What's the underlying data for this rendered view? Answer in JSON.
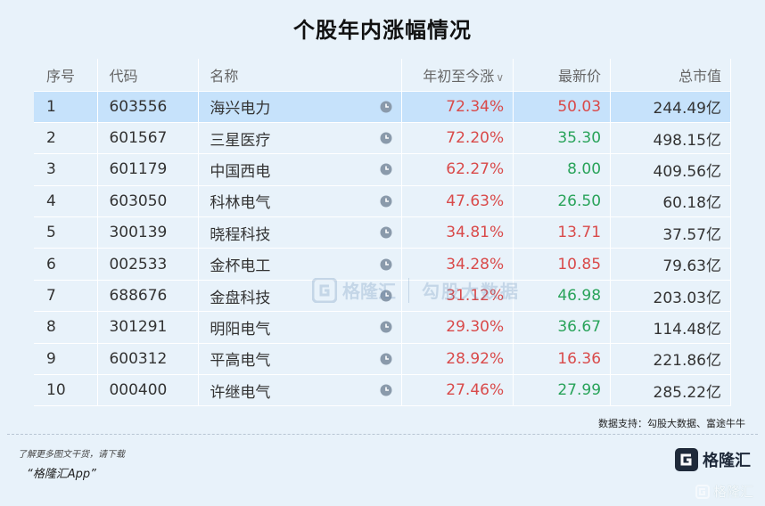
{
  "title": "个股年内涨幅情况",
  "headers": {
    "index": "序号",
    "code": "代码",
    "name": "名称",
    "change": "年初至今涨",
    "price": "最新价",
    "market_cap": "总市值"
  },
  "sort_arrow": "∨",
  "rows": [
    {
      "index": "1",
      "code": "603556",
      "name": "海兴电力",
      "change": "72.34%",
      "price": "50.03",
      "market_cap": "244.49亿",
      "price_dir": "red"
    },
    {
      "index": "2",
      "code": "601567",
      "name": "三星医疗",
      "change": "72.20%",
      "price": "35.30",
      "market_cap": "498.15亿",
      "price_dir": "green"
    },
    {
      "index": "3",
      "code": "601179",
      "name": "中国西电",
      "change": "62.27%",
      "price": "8.00",
      "market_cap": "409.56亿",
      "price_dir": "green"
    },
    {
      "index": "4",
      "code": "603050",
      "name": "科林电气",
      "change": "47.63%",
      "price": "26.50",
      "market_cap": "60.18亿",
      "price_dir": "green"
    },
    {
      "index": "5",
      "code": "300139",
      "name": "晓程科技",
      "change": "34.81%",
      "price": "13.71",
      "market_cap": "37.57亿",
      "price_dir": "red"
    },
    {
      "index": "6",
      "code": "002533",
      "name": "金杯电工",
      "change": "34.28%",
      "price": "10.85",
      "market_cap": "79.63亿",
      "price_dir": "red"
    },
    {
      "index": "7",
      "code": "688676",
      "name": "金盘科技",
      "change": "31.12%",
      "price": "46.98",
      "market_cap": "203.03亿",
      "price_dir": "green"
    },
    {
      "index": "8",
      "code": "301291",
      "name": "明阳电气",
      "change": "29.30%",
      "price": "36.67",
      "market_cap": "114.48亿",
      "price_dir": "green"
    },
    {
      "index": "9",
      "code": "600312",
      "name": "平高电气",
      "change": "28.92%",
      "price": "16.36",
      "market_cap": "221.86亿",
      "price_dir": "red"
    },
    {
      "index": "10",
      "code": "000400",
      "name": "许继电气",
      "change": "27.46%",
      "price": "27.99",
      "market_cap": "285.22亿",
      "price_dir": "green"
    }
  ],
  "source": "数据支持：勾股大数据、富途牛牛",
  "promo_line1": "了解更多图文干货，请下载",
  "promo_line2": "“格隆汇App”",
  "logo_text": "格隆汇",
  "watermark_brand": "格隆汇",
  "watermark_product": "勾股大数据",
  "watermark_corner": "格隆汇",
  "colors": {
    "up": "#d94a4a",
    "down": "#29a35a",
    "selected_row": "#c6e2fb",
    "background": "#e8f2fa"
  },
  "icons": {
    "row_action": "clock-icon",
    "brand": "g-logo-icon"
  },
  "selected_row": 0
}
